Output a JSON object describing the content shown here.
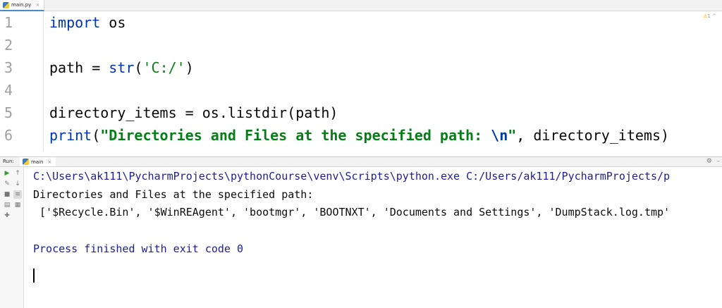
{
  "editor_tab": {
    "filename": "main.py",
    "close": "×"
  },
  "editor": {
    "line_numbers": [
      "1",
      "2",
      "3",
      "4",
      "5",
      "6"
    ],
    "lines": [
      {
        "kw": "import",
        "rest": " os"
      },
      {
        "text": ""
      },
      {
        "prefix": "path = ",
        "builtin": "str",
        "open": "(",
        "string": "'C:/'",
        "close": ")"
      },
      {
        "text": ""
      },
      {
        "text": "directory_items = os.listdir(path)"
      },
      {
        "fn": "print",
        "open": "(",
        "string": "\"Directories and Files at the specified path: ",
        "escape": "\\n",
        "quote_end": "\"",
        "rest": ", directory_items)"
      }
    ],
    "inspection": {
      "warn_glyph": "⚠",
      "count": "1",
      "arrow": "^"
    }
  },
  "run_window": {
    "label": "Run:",
    "tab": "main",
    "tab_close": "×",
    "icons": {
      "settings": "gear-icon",
      "hide": "minimize-icon",
      "rerun": "play-icon",
      "wrench": "wrench-icon",
      "stop": "stop-icon",
      "up": "arrow-up-icon",
      "down": "arrow-down-icon",
      "soft_wrap": "soft-wrap-icon",
      "print": "print-icon",
      "pin": "pin-icon"
    },
    "console": {
      "command": "C:\\Users\\ak111\\PycharmProjects\\pythonCourse\\venv\\Scripts\\python.exe C:/Users/ak111/PycharmProjects/p",
      "output_1": "Directories and Files at the specified path: ",
      "output_2": " ['$Recycle.Bin', '$WinREAgent', 'bootmgr', 'BOOTNXT', 'Documents and Settings', 'DumpStack.log.tmp'",
      "blank": "",
      "exit": "Process finished with exit code 0"
    }
  },
  "colors": {
    "keyword": "#0033b3",
    "string": "#067d17",
    "console_system": "#1c1c9a",
    "gutter_text": "#a0a0a0"
  }
}
